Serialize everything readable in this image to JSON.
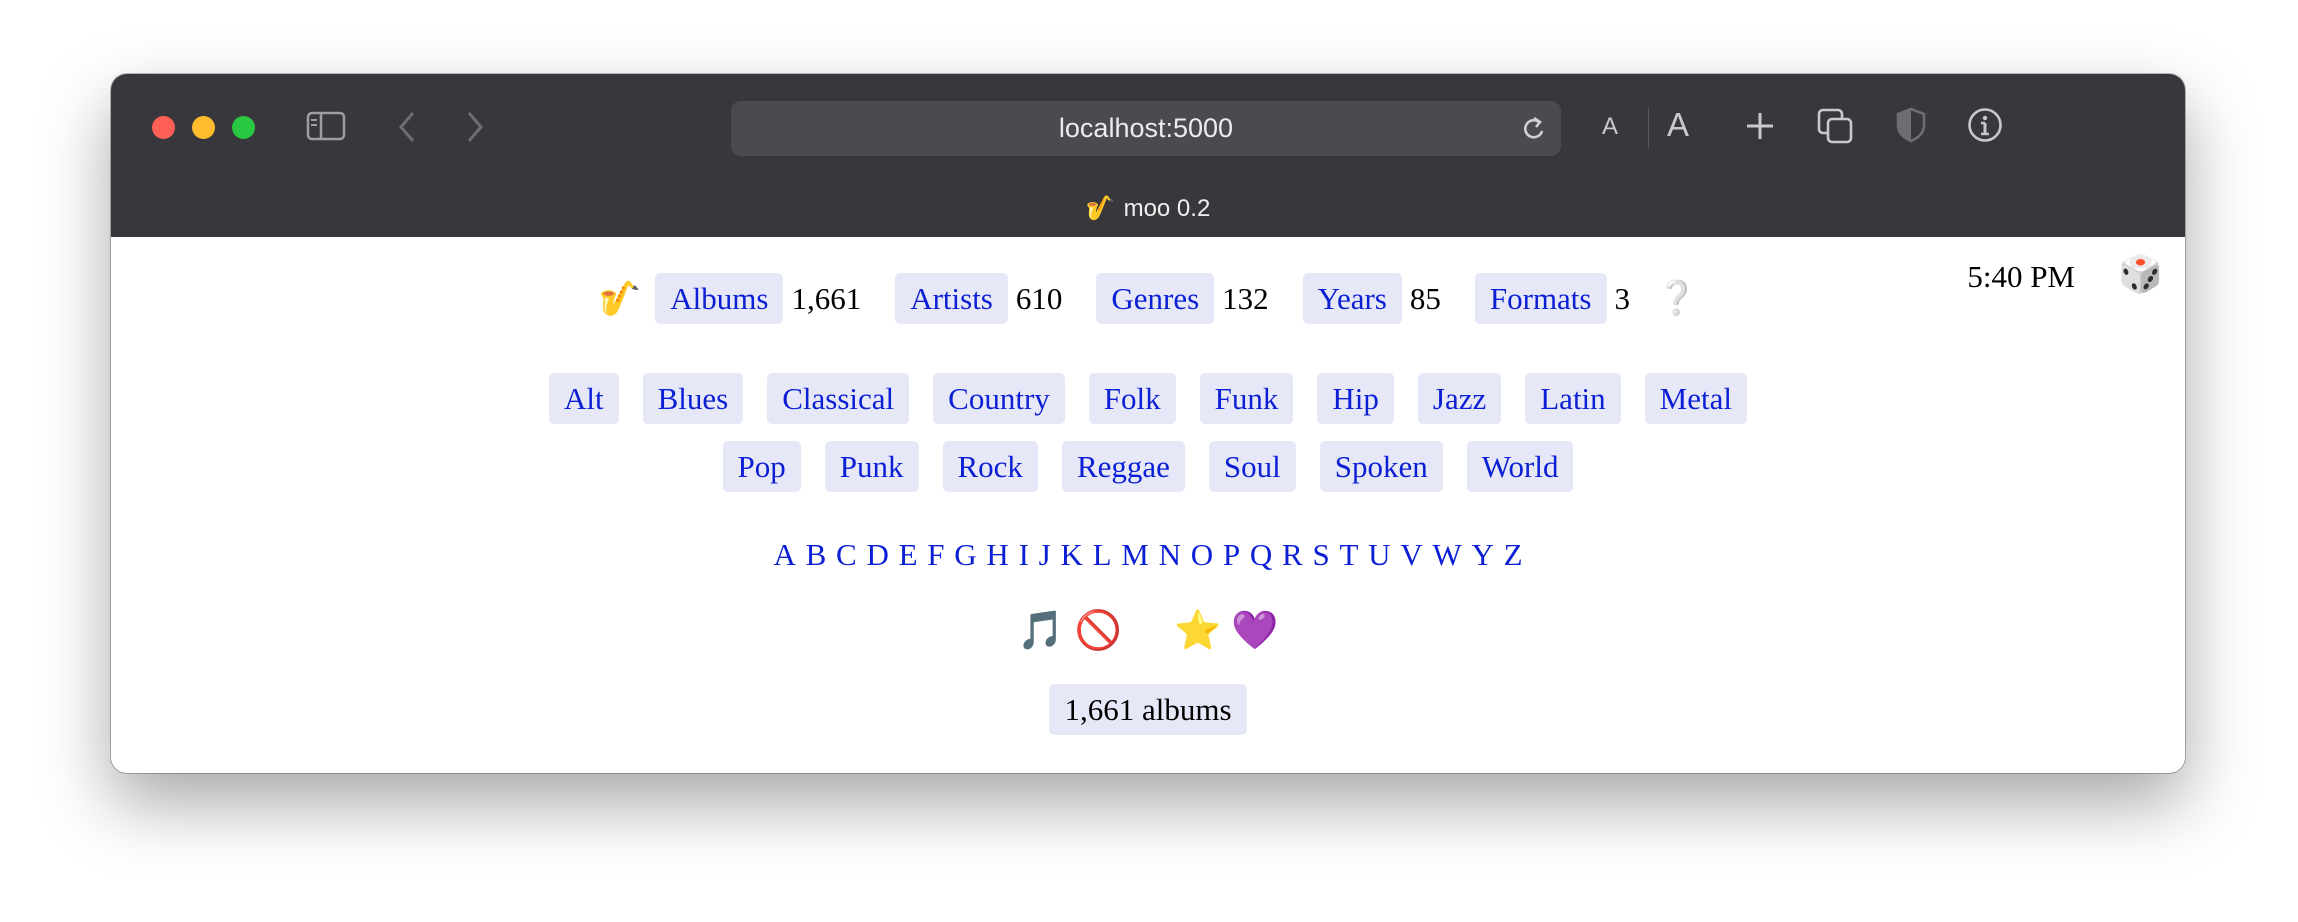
{
  "browser": {
    "url": "localhost:5000",
    "tab_title": "moo 0.2",
    "tab_icon": "🎷",
    "font_small": "A",
    "font_large": "A"
  },
  "stats": {
    "logo": "🎷",
    "albums": {
      "label": "Albums",
      "count": "1,661"
    },
    "artists": {
      "label": "Artists",
      "count": "610"
    },
    "genres": {
      "label": "Genres",
      "count": "132"
    },
    "years": {
      "label": "Years",
      "count": "85"
    },
    "formats": {
      "label": "Formats",
      "count": "3"
    },
    "help": "❔"
  },
  "clock": "5:40 PM",
  "dice": "🎲",
  "genre_buttons": {
    "row1": [
      "Alt",
      "Blues",
      "Classical",
      "Country",
      "Folk",
      "Funk",
      "Hip",
      "Jazz",
      "Latin",
      "Metal"
    ],
    "row2": [
      "Pop",
      "Punk",
      "Rock",
      "Reggae",
      "Soul",
      "Spoken",
      "World"
    ]
  },
  "letters": [
    "A",
    "B",
    "C",
    "D",
    "E",
    "F",
    "G",
    "H",
    "I",
    "J",
    "K",
    "L",
    "M",
    "N",
    "O",
    "P",
    "Q",
    "R",
    "S",
    "T",
    "U",
    "V",
    "W",
    "Y",
    "Z"
  ],
  "filters": {
    "music": "🎵",
    "no": "🚫",
    "star": "⭐",
    "heart": "💜"
  },
  "total": "1,661 albums",
  "colors": {
    "link": "#0b1fd4",
    "pill_bg": "#e6e7f7",
    "titlebar": "#38373c"
  }
}
